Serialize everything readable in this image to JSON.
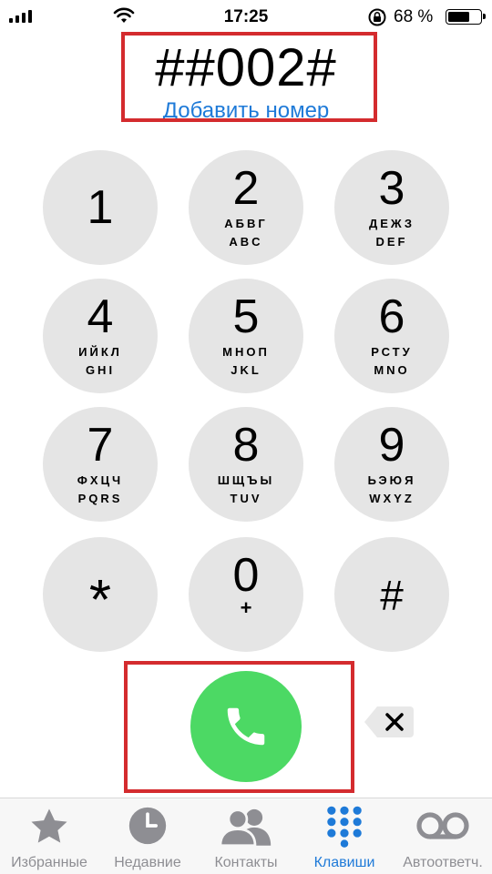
{
  "status_bar": {
    "time": "17:25",
    "battery_percent": "68 %",
    "battery_level": 0.68
  },
  "dialer": {
    "number": "##002#",
    "add_number_label": "Добавить номер"
  },
  "keys": [
    {
      "digit": "1",
      "cyr": "",
      "lat": ""
    },
    {
      "digit": "2",
      "cyr": "АБВГ",
      "lat": "ABC"
    },
    {
      "digit": "3",
      "cyr": "ДЕЖЗ",
      "lat": "DEF"
    },
    {
      "digit": "4",
      "cyr": "ИЙКЛ",
      "lat": "GHI"
    },
    {
      "digit": "5",
      "cyr": "МНОП",
      "lat": "JKL"
    },
    {
      "digit": "6",
      "cyr": "РСТУ",
      "lat": "MNO"
    },
    {
      "digit": "7",
      "cyr": "ФХЦЧ",
      "lat": "PQRS"
    },
    {
      "digit": "8",
      "cyr": "ШЩЪЫ",
      "lat": "TUV"
    },
    {
      "digit": "9",
      "cyr": "ЬЭЮЯ",
      "lat": "WXYZ"
    },
    {
      "digit": "*"
    },
    {
      "digit": "0",
      "sub": "+"
    },
    {
      "digit": "#"
    }
  ],
  "tabs": [
    {
      "label": "Избранные",
      "icon": "star-icon",
      "active": false
    },
    {
      "label": "Недавние",
      "icon": "clock-icon",
      "active": false
    },
    {
      "label": "Контакты",
      "icon": "contacts-icon",
      "active": false
    },
    {
      "label": "Клавиши",
      "icon": "keypad-icon",
      "active": true
    },
    {
      "label": "Автоответч.",
      "icon": "voicemail-icon",
      "active": false
    }
  ],
  "colors": {
    "accent": "#1e7ad8",
    "call_green": "#4cd964",
    "key_gray": "#e5e5e5",
    "highlight_red": "#d42b2e",
    "inactive_gray": "#8e8e93"
  }
}
